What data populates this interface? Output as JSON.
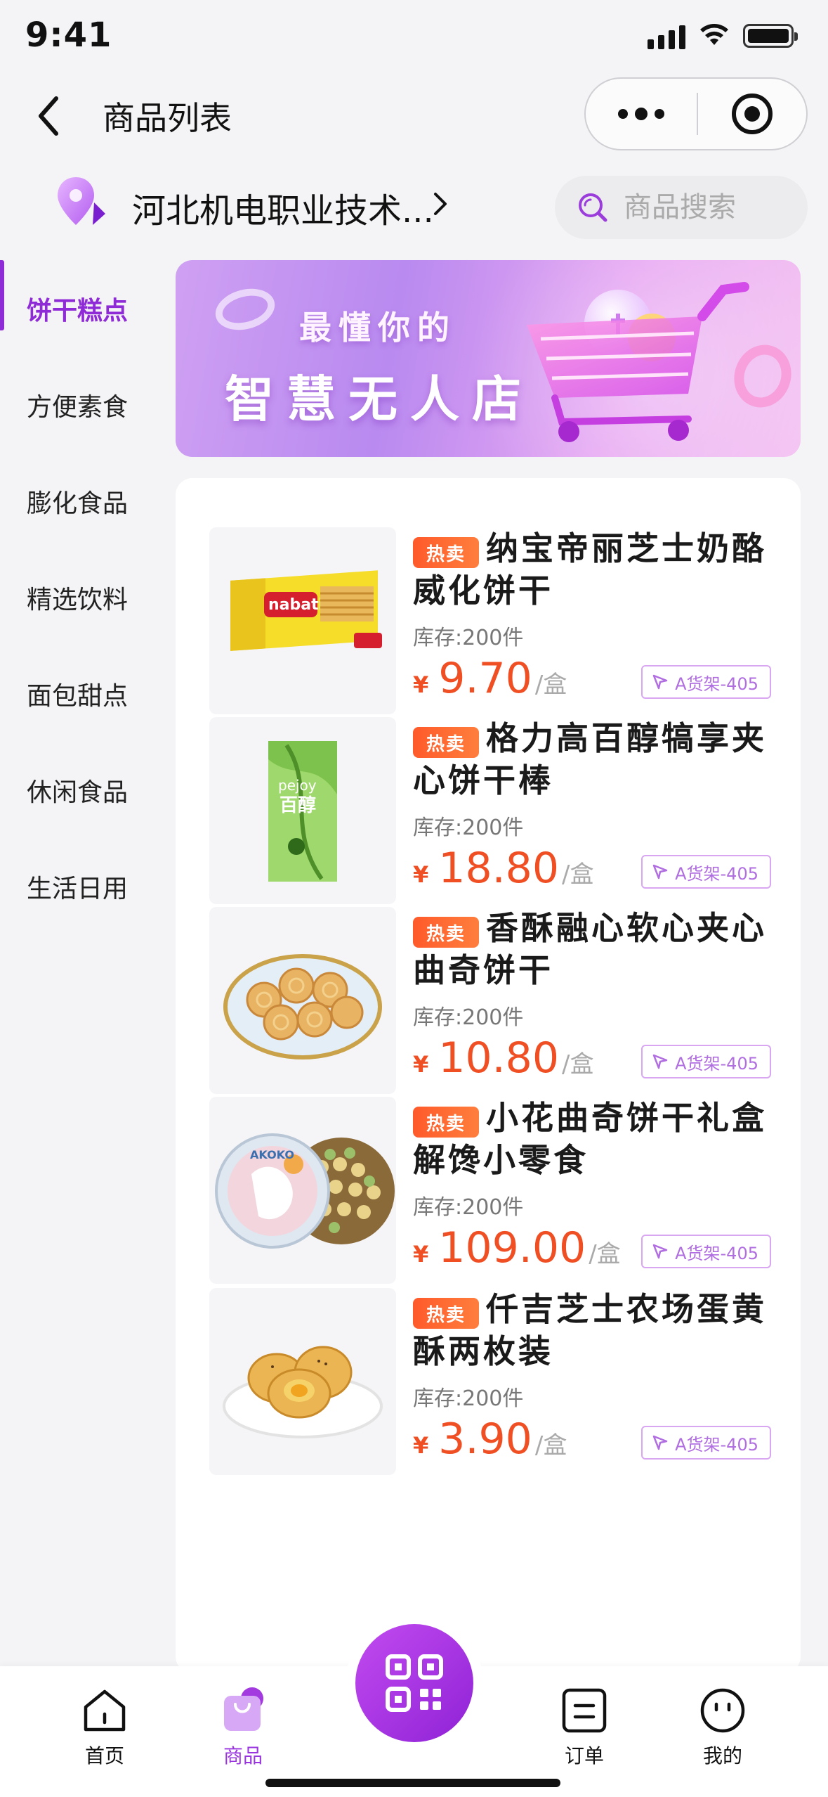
{
  "status_bar": {
    "time": "9:41"
  },
  "nav": {
    "title": "商品列表"
  },
  "location": {
    "store_name": "河北机电职业技术..."
  },
  "search": {
    "placeholder": "商品搜索"
  },
  "sidebar": {
    "items": [
      {
        "label": "饼干糕点",
        "active": true
      },
      {
        "label": "方便素食"
      },
      {
        "label": "膨化食品"
      },
      {
        "label": "精选饮料"
      },
      {
        "label": "面包甜点"
      },
      {
        "label": "休闲食品"
      },
      {
        "label": "生活日用"
      }
    ]
  },
  "banner": {
    "line1": "最懂你的",
    "line2": "智慧无人店"
  },
  "products": [
    {
      "badge": "热卖",
      "name": "纳宝帝丽芝士奶酪威化饼干",
      "stock": "库存:200件",
      "currency": "¥",
      "price": "9.70",
      "unit": "/盒",
      "shelf": "A货架-405"
    },
    {
      "badge": "热卖",
      "name": "格力高百醇犒享夹心饼干棒",
      "stock": "库存:200件",
      "currency": "¥",
      "price": "18.80",
      "unit": "/盒",
      "shelf": "A货架-405"
    },
    {
      "badge": "热卖",
      "name": "香酥融心软心夹心曲奇饼干",
      "stock": "库存:200件",
      "currency": "¥",
      "price": "10.80",
      "unit": "/盒",
      "shelf": "A货架-405"
    },
    {
      "badge": "热卖",
      "name": "小花曲奇饼干礼盒解馋小零食",
      "stock": "库存:200件",
      "currency": "¥",
      "price": "109.00",
      "unit": "/盒",
      "shelf": "A货架-405"
    },
    {
      "badge": "热卖",
      "name": "仟吉芝士农场蛋黄酥两枚装",
      "stock": "库存:200件",
      "currency": "¥",
      "price": "3.90",
      "unit": "/盒",
      "shelf": "A货架-405"
    }
  ],
  "tabbar": {
    "home": "首页",
    "goods": "商品",
    "orders": "订单",
    "mine": "我的"
  },
  "colors": {
    "accent": "#8f2bd6",
    "price": "#f04e23",
    "hot": "#ff5a2a"
  }
}
